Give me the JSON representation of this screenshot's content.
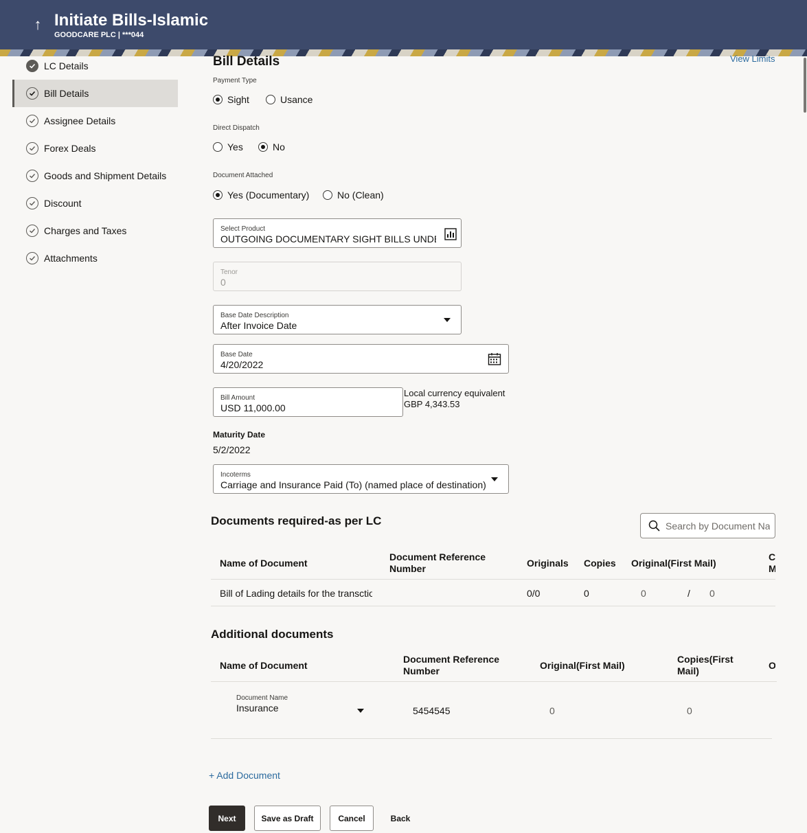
{
  "header": {
    "title": "Initiate Bills-Islamic",
    "subtitle": "GOODCARE PLC | ***044"
  },
  "sidebar": {
    "items": [
      {
        "label": "LC Details"
      },
      {
        "label": "Bill Details"
      },
      {
        "label": "Assignee Details"
      },
      {
        "label": "Forex Deals"
      },
      {
        "label": "Goods and Shipment Details"
      },
      {
        "label": "Discount"
      },
      {
        "label": "Charges and Taxes"
      },
      {
        "label": "Attachments"
      }
    ]
  },
  "main": {
    "section_title": "Bill Details",
    "view_limits": "View Limits",
    "payment_type": {
      "label": "Payment Type",
      "options": [
        "Sight",
        "Usance"
      ],
      "selected": "Sight"
    },
    "direct_dispatch": {
      "label": "Direct Dispatch",
      "options": [
        "Yes",
        "No"
      ],
      "selected": "No"
    },
    "document_attached": {
      "label": "Document Attached",
      "options": [
        "Yes (Documentary)",
        "No (Clean)"
      ],
      "selected": "Yes (Documentary)"
    },
    "select_product": {
      "label": "Select Product",
      "value": "OUTGOING DOCUMENTARY SIGHT BILLS UNDER LC"
    },
    "tenor": {
      "label": "Tenor",
      "value": "0"
    },
    "base_date_description": {
      "label": "Base Date Description",
      "value": "After Invoice Date"
    },
    "base_date": {
      "label": "Base Date",
      "value": "4/20/2022"
    },
    "bill_amount": {
      "label": "Bill Amount",
      "value": "USD 11,000.00"
    },
    "local_equivalent": {
      "label": "Local currency equivalent",
      "value": "GBP 4,343.53"
    },
    "maturity_date": {
      "label": "Maturity Date",
      "value": "5/2/2022"
    },
    "incoterms": {
      "label": "Incoterms",
      "value": "Carriage and Insurance Paid (To) (named place of destination)"
    }
  },
  "documents_lc": {
    "title": "Documents required-as per LC",
    "search_placeholder": "Search by Document Name",
    "columns": [
      "Name of Document",
      "Document Reference Number",
      "Originals",
      "Copies",
      "Original(First Mail)",
      "Copies(First Mail)"
    ],
    "rows": [
      {
        "name": "Bill of Lading details for the transction",
        "ref": "",
        "originals": "0/0",
        "copies": "0",
        "orig_first_a": "0",
        "sep": "/",
        "orig_first_b": "0"
      }
    ]
  },
  "additional_docs": {
    "title": "Additional documents",
    "columns": [
      "Name of Document",
      "Document Reference Number",
      "Original(First Mail)",
      "Copies(First Mail)",
      "Originals"
    ],
    "rows": [
      {
        "name_label": "Document Name",
        "name_value": "Insurance",
        "ref": "5454545",
        "orig_first": "0",
        "copies_first": "0"
      }
    ],
    "add_label": "+ Add Document"
  },
  "actions": {
    "next": "Next",
    "save_draft": "Save as Draft",
    "cancel": "Cancel",
    "back": "Back"
  },
  "colors": {
    "header_bg": "#3d4a6b",
    "primary_button": "#312d2a",
    "link": "#2b6a9e"
  }
}
